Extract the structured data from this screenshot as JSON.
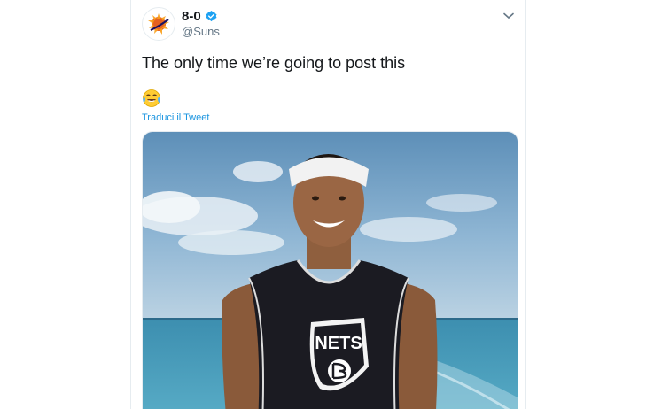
{
  "tweet": {
    "display_name": "8-0",
    "handle": "@Suns",
    "text": "The only time we’re going to post this",
    "emoji": "😂",
    "translate_label": "Traduci il Tweet",
    "jersey_text": "NETS"
  },
  "icons": {
    "avatar": "suns-logo-icon",
    "verified": "verified-badge-icon",
    "menu": "chevron-down-icon"
  },
  "colors": {
    "link": "#1b95e0",
    "verified": "#1da1f2",
    "text": "#14171a",
    "secondary": "#657786"
  }
}
